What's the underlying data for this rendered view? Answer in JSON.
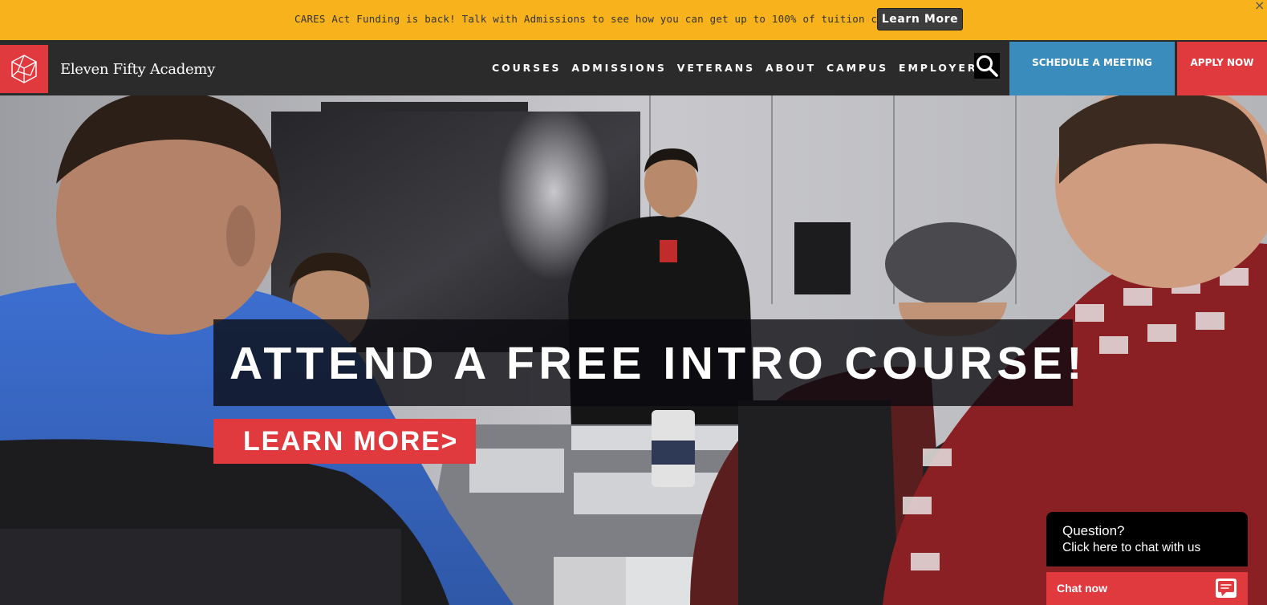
{
  "announcement": {
    "message": "CARES Act Funding is back! Talk with Admissions to see how you can get up to 100% of tuition covered.",
    "button_label": "Learn More",
    "close_symbol": "×"
  },
  "header": {
    "brand": "Eleven Fifty Academy",
    "logo_icon": "polyhedron-logo-icon",
    "nav": [
      {
        "label": "COURSES"
      },
      {
        "label": "ADMISSIONS"
      },
      {
        "label": "VETERANS"
      },
      {
        "label": "ABOUT"
      },
      {
        "label": "CAMPUS"
      },
      {
        "label": "EMPLOYERS"
      }
    ],
    "search_icon": "search-icon",
    "schedule_label": "SCHEDULE A MEETING",
    "apply_label": "APPLY NOW"
  },
  "hero": {
    "headline": "ATTEND A FREE INTRO COURSE!",
    "cta_label": "LEARN MORE>"
  },
  "chat": {
    "question": "Question?",
    "prompt": "Click here to chat with us",
    "bar_label": "Chat now",
    "icon": "chat-bubble-icon"
  },
  "colors": {
    "announcement_bg": "#f8b31c",
    "nav_bg": "#2b2b2b",
    "brand_red": "#e03a3e",
    "schedule_blue": "#3a8cbc"
  }
}
